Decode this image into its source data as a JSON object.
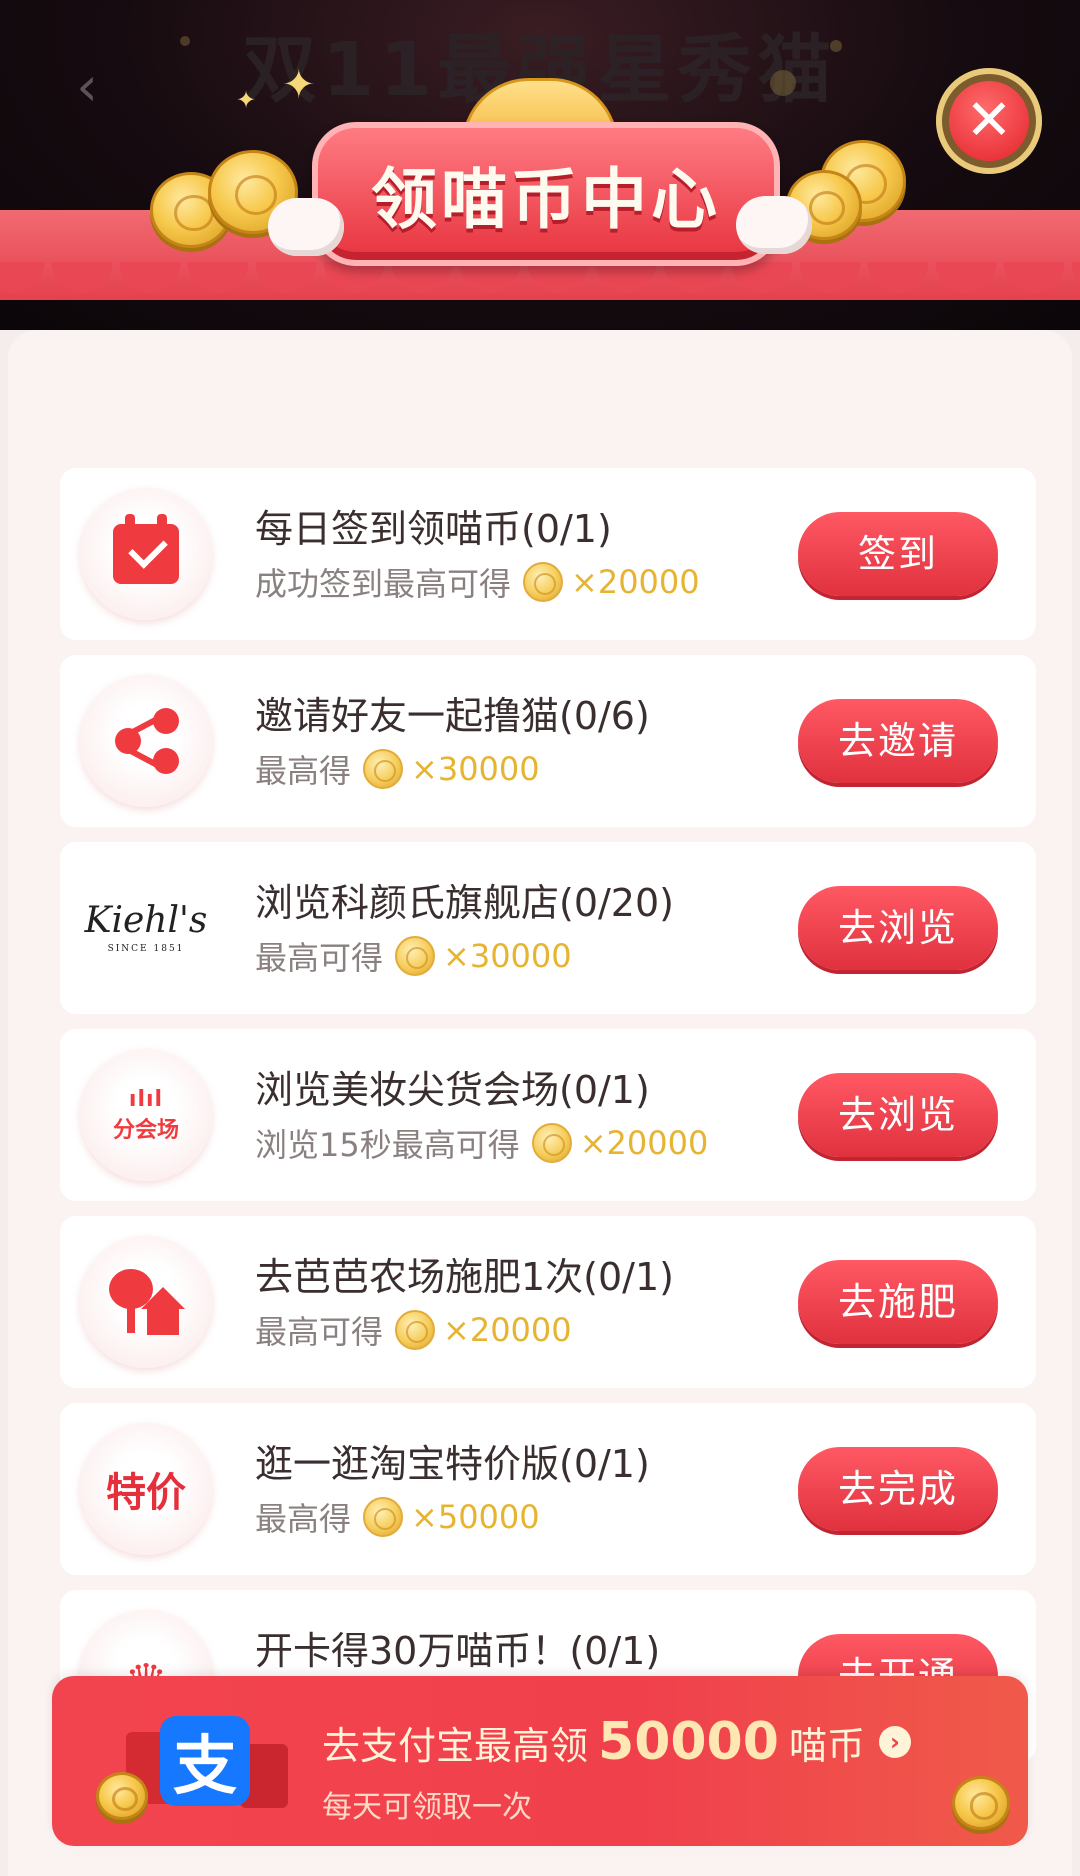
{
  "header": {
    "bg_title": "双11最强星秀猫",
    "title": "领喵币中心",
    "back_glyph": "‹",
    "close_glyph": "✕"
  },
  "tasks": [
    {
      "title": "每日签到领喵币(0/1)",
      "sub": "成功签到最高可得",
      "reward": "×20000",
      "button": "签到",
      "icon": "calendar-icon"
    },
    {
      "title": "邀请好友一起撸猫(0/6)",
      "sub": "最高得",
      "reward": "×30000",
      "button": "去邀请",
      "icon": "share-icon"
    },
    {
      "title": "浏览科颜氏旗舰店(0/20)",
      "sub": "最高可得",
      "reward": "×30000",
      "button": "去浏览",
      "icon": "kiehls-logo",
      "logo_text": "Kiehl's",
      "logo_sub": "SINCE 1851"
    },
    {
      "title": "浏览美妆尖货会场(0/1)",
      "sub": "浏览15秒最高可得",
      "reward": "×20000",
      "button": "去浏览",
      "icon": "venue-icon",
      "logo_text": "分会场"
    },
    {
      "title": "去芭芭农场施肥1次(0/1)",
      "sub": "最高可得",
      "reward": "×20000",
      "button": "去施肥",
      "icon": "farm-icon"
    },
    {
      "title": "逛一逛淘宝特价版(0/1)",
      "sub": "最高得",
      "reward": "×50000",
      "button": "去完成",
      "icon": "tejia-icon",
      "logo_text": "特价"
    },
    {
      "title": "开卡得30万喵币！(0/1)",
      "button": "去开通",
      "icon": "crown-icon"
    }
  ],
  "banner": {
    "logo": "支",
    "text_prefix": "去支付宝最高领",
    "amount": "50000",
    "text_suffix": "喵币",
    "subtext": "每天可领取一次",
    "arrow": "›"
  },
  "colors": {
    "accent": "#e0313e",
    "reward": "#e7b431",
    "alipay": "#1677ff"
  }
}
